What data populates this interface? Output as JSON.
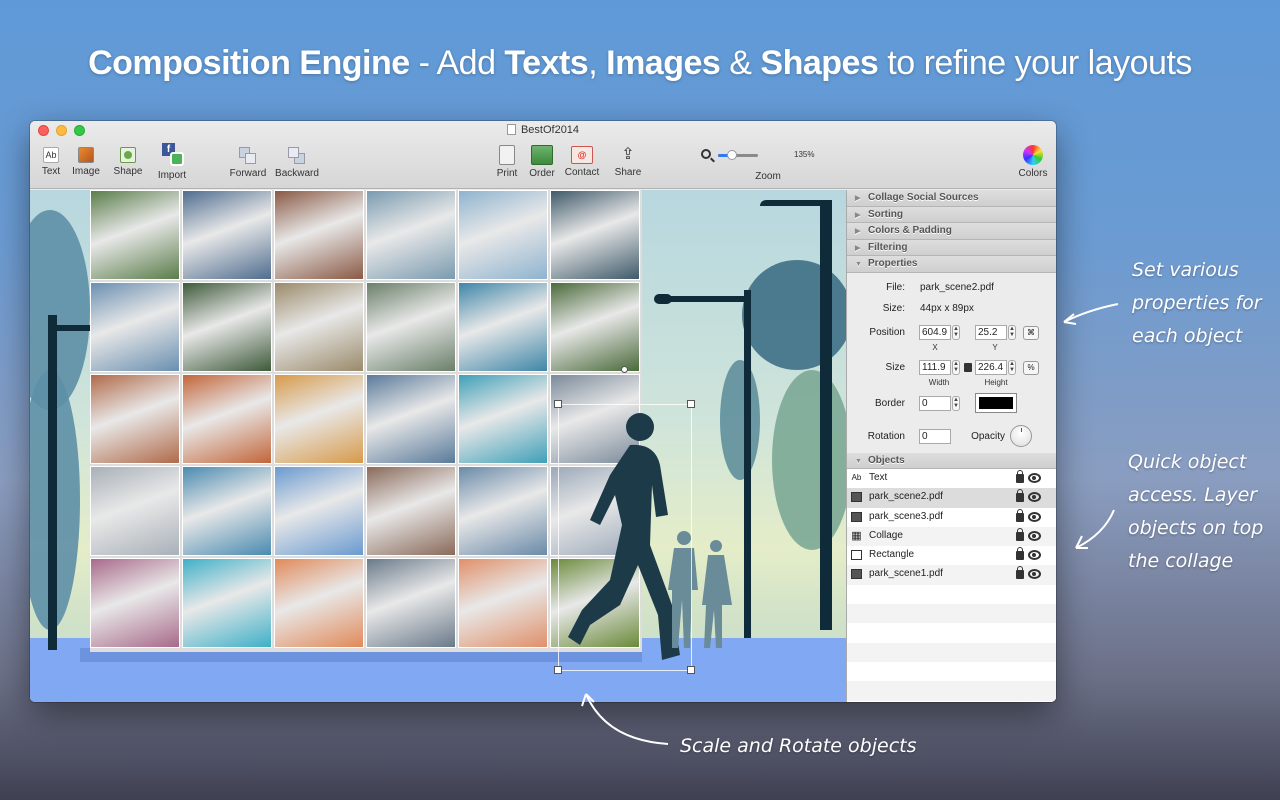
{
  "headline": {
    "part1_bold": "Composition Engine",
    "part2": " - Add ",
    "part3_bold": "Texts",
    "part4": ", ",
    "part5_bold": "Images",
    "part6": " & ",
    "part7_bold": "Shapes",
    "part8": " to refine your layouts"
  },
  "window": {
    "title": "BestOf2014",
    "toolbar": {
      "text": "Text",
      "image": "Image",
      "shape": "Shape",
      "import": "Import",
      "forward": "Forward",
      "backward": "Backward",
      "print": "Print",
      "order": "Order",
      "contact": "Contact",
      "share": "Share",
      "zoom": "Zoom",
      "zoom_value": "135%",
      "zoom_level": 0.35,
      "colors": "Colors"
    }
  },
  "sidebar": {
    "sections": [
      "Collage Social Sources",
      "Sorting",
      "Colors & Padding",
      "Filtering"
    ],
    "properties_header": "Properties",
    "properties": {
      "file_label": "File:",
      "file_value": "park_scene2.pdf",
      "size_label": "Size:",
      "size_value": "44px x 89px",
      "position_label": "Position",
      "position_x": "604.9",
      "position_y": "25.2",
      "x_label": "X",
      "y_label": "Y",
      "dim_label": "Size",
      "width_value": "111.9",
      "height_value": "226.4",
      "width_label": "Width",
      "height_label": "Height",
      "border_label": "Border",
      "border_value": "0",
      "border_color": "#000000",
      "rotation_label": "Rotation",
      "rotation_value": "0",
      "opacity_label": "Opacity"
    },
    "objects_header": "Objects",
    "objects": [
      {
        "name": "Text",
        "icon": "Ab",
        "selected": false
      },
      {
        "name": "park_scene2.pdf",
        "icon": "image",
        "selected": true
      },
      {
        "name": "park_scene3.pdf",
        "icon": "image",
        "selected": false
      },
      {
        "name": "Collage",
        "icon": "grid",
        "selected": false
      },
      {
        "name": "Rectangle",
        "icon": "square",
        "selected": false
      },
      {
        "name": "park_scene1.pdf",
        "icon": "image",
        "selected": false
      }
    ]
  },
  "annotations": {
    "properties_note_1": "Set various",
    "properties_note_2": "properties for",
    "properties_note_3": "each object",
    "objects_note_1": "Quick object",
    "objects_note_2": "access. Layer",
    "objects_note_3": "objects on top",
    "objects_note_4": "the collage",
    "scale_note": "Scale and Rotate objects"
  },
  "colors": {
    "accent": "#2d7bf0",
    "ground": "#80a8f3"
  },
  "collage_tiles": [
    "#5a7d4a",
    "#4f6d8f",
    "#8a5a45",
    "#7a9bb0",
    "#8fb3cf",
    "#3f5a6a",
    "#6a8fb0",
    "#3e5a3a",
    "#9a8a6a",
    "#6a7f6a",
    "#3f86a8",
    "#4a6a3a",
    "#b06a4a",
    "#c2663a",
    "#d79a4a",
    "#5a7a9a",
    "#3fa0b8",
    "#7a8a9a",
    "#a8b0b8",
    "#4a8ab0",
    "#6a9ad0",
    "#8a6a5a",
    "#6a8aa8",
    "#9aa8b8",
    "#a86a8a",
    "#3fb0c8",
    "#e08a5a",
    "#6a7a8a",
    "#e0906a",
    "#6a8a3a"
  ]
}
